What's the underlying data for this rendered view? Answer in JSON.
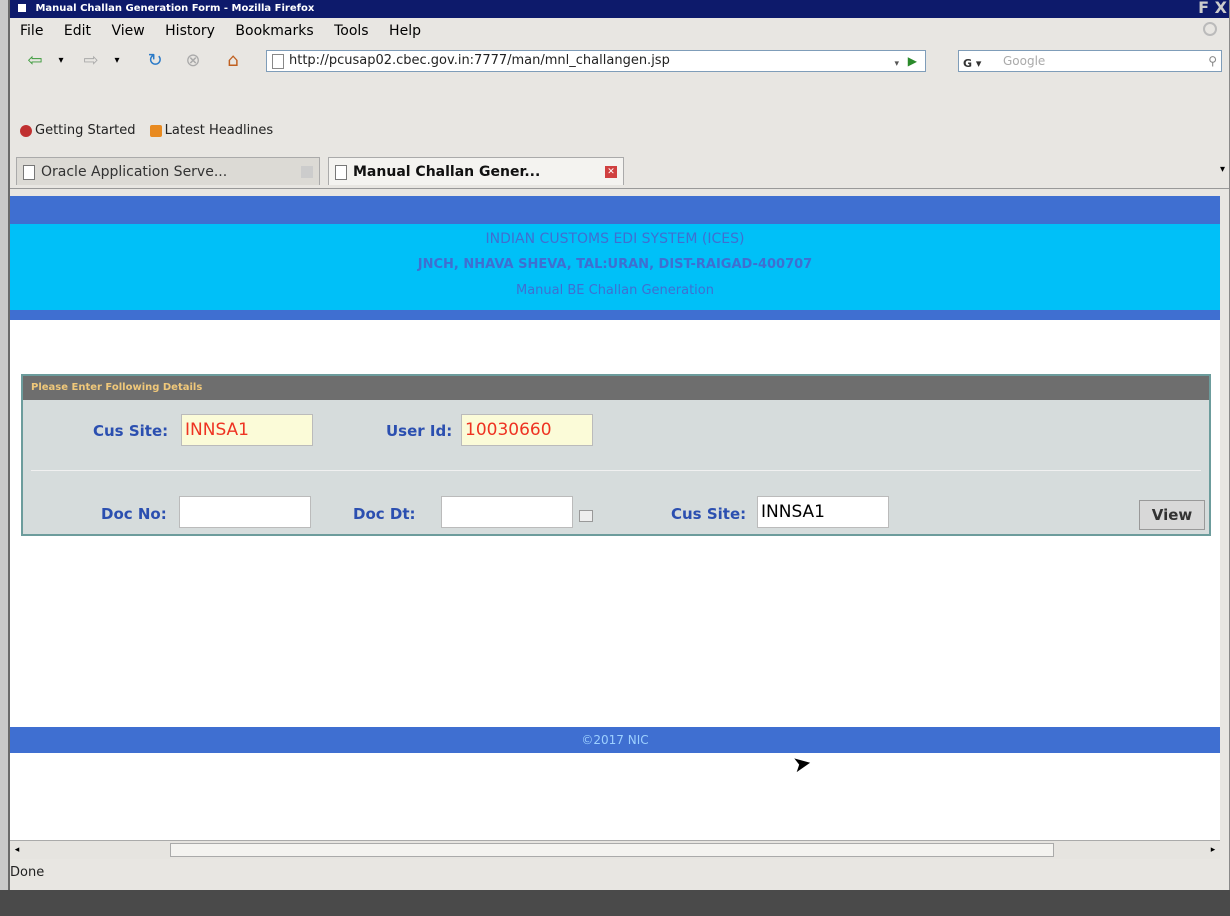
{
  "window": {
    "title": "Manual Challan Generation Form - Mozilla Firefox",
    "title_controls": "F X"
  },
  "menu": [
    "File",
    "Edit",
    "View",
    "History",
    "Bookmarks",
    "Tools",
    "Help"
  ],
  "nav": {
    "url": "http://pcusap02.cbec.gov.in:7777/man/mnl_challangen.jsp",
    "search_engine": "G",
    "search_placeholder": "Google"
  },
  "bookmarks": [
    "Getting Started",
    "Latest Headlines"
  ],
  "tabs": [
    {
      "label": "Oracle Application Serve...",
      "active": false
    },
    {
      "label": "Manual Challan Gener...",
      "active": true
    }
  ],
  "page": {
    "header_line1": "INDIAN CUSTOMS EDI SYSTEM (ICES)",
    "header_line2": "JNCH, NHAVA SHEVA, TAL:URAN, DIST-RAIGAD-400707",
    "header_line3": "Manual BE Challan Generation",
    "form_title": "Please Enter Following Details",
    "cus_site_label": "Cus Site:",
    "cus_site_value": "INNSA1",
    "user_id_label": "User Id:",
    "user_id_value": "10030660",
    "doc_no_label": "Doc No:",
    "doc_no_value": "",
    "doc_dt_label": "Doc Dt:",
    "doc_dt_value": "",
    "cus_site2_label": "Cus Site:",
    "cus_site2_value": "INNSA1",
    "view_button": "View",
    "footer": "©2017 NIC"
  },
  "status": {
    "text": "Done"
  },
  "colors": {
    "band": "#3f6fd1",
    "header_bg": "#00c0f8",
    "form_bg": "#d6dcdc",
    "readonly_text": "#e32222"
  }
}
